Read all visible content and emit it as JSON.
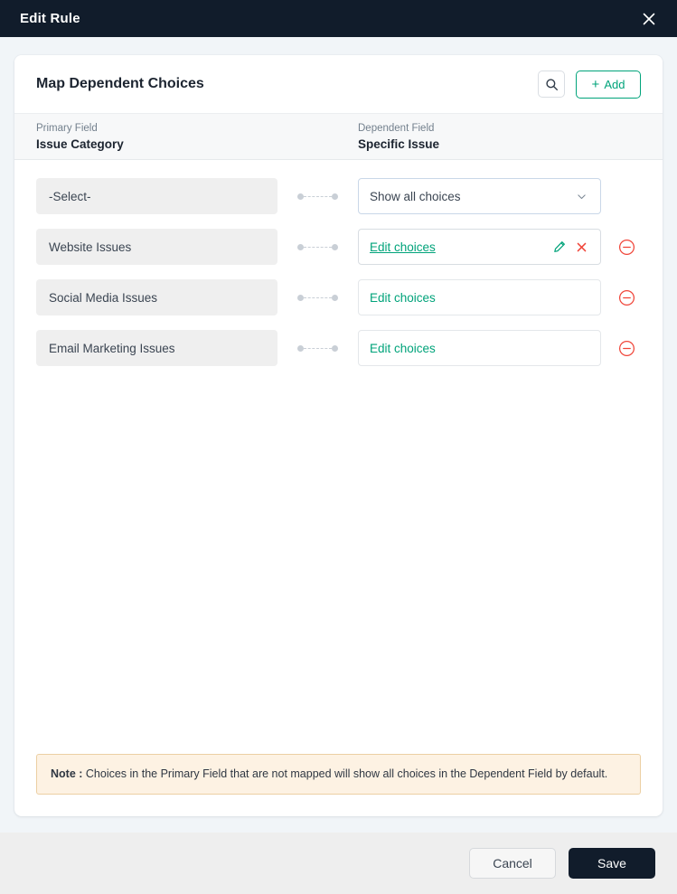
{
  "titlebar": {
    "title": "Edit Rule",
    "close_icon": "close-icon"
  },
  "card": {
    "title": "Map Dependent Choices",
    "search_icon": "search-icon",
    "add_button": {
      "label": "Add",
      "plus": "+"
    }
  },
  "columns": {
    "primary": {
      "label": "Primary Field",
      "value": "Issue Category"
    },
    "dependent": {
      "label": "Dependent Field",
      "value": "Specific Issue"
    }
  },
  "rows": [
    {
      "primary": "-Select-",
      "dependent": "Show all choices",
      "type": "select",
      "underlined": false,
      "has_chevron": true,
      "has_inline_icons": false,
      "has_remove": false
    },
    {
      "primary": "Website Issues",
      "dependent": "Edit choices",
      "type": "link",
      "underlined": true,
      "has_chevron": false,
      "has_inline_icons": true,
      "has_remove": true,
      "edit_icon": "pencil-icon",
      "clear_icon": "x-icon"
    },
    {
      "primary": "Social Media Issues",
      "dependent": "Edit choices",
      "type": "link",
      "underlined": false,
      "has_chevron": false,
      "has_inline_icons": false,
      "has_remove": true
    },
    {
      "primary": "Email Marketing Issues",
      "dependent": "Edit choices",
      "type": "link",
      "underlined": false,
      "has_chevron": false,
      "has_inline_icons": false,
      "has_remove": true
    }
  ],
  "note": {
    "prefix": "Note :",
    "text": " Choices in the Primary Field that are not mapped will show all choices in the Dependent Field by default."
  },
  "footer": {
    "cancel_label": "Cancel",
    "save_label": "Save"
  },
  "colors": {
    "accent_green": "#00a37a",
    "danger_red": "#f04438",
    "dark_navy": "#111c2b",
    "note_bg": "#fdf2e3",
    "note_border": "#eccfa3"
  }
}
